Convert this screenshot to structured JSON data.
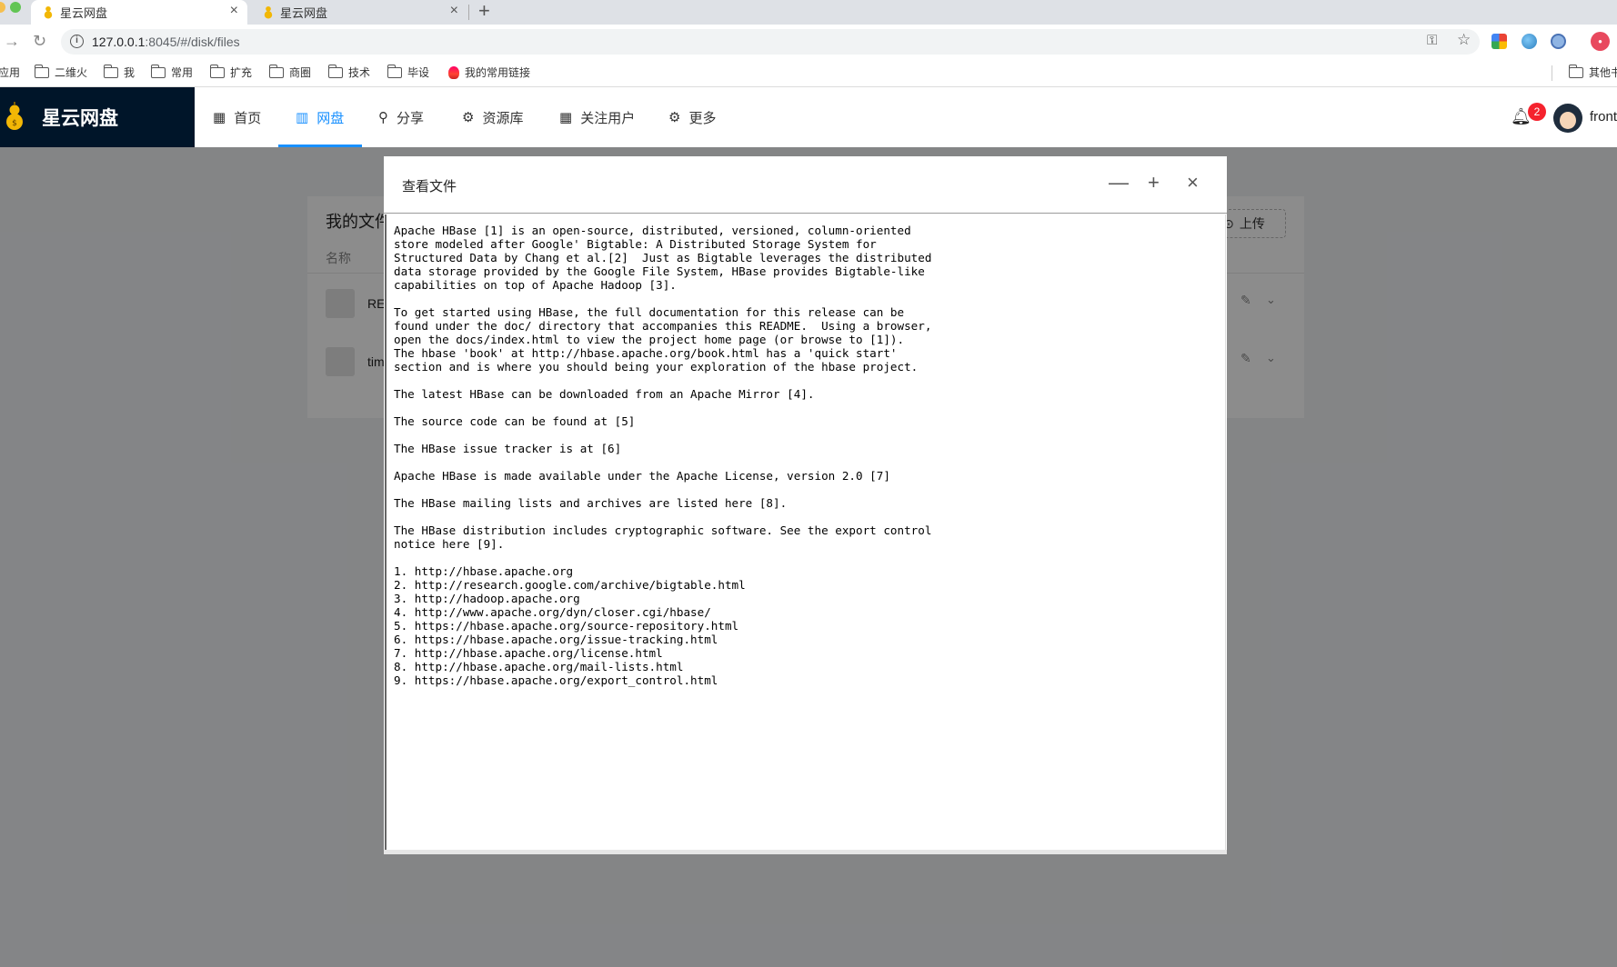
{
  "browser": {
    "tabs": [
      {
        "title": "星云网盘",
        "active": true,
        "close": "×"
      },
      {
        "title": "星云网盘",
        "active": false,
        "close": "×"
      }
    ],
    "new_tab": "+",
    "url_host": "127.0.0.1",
    "url_rest": ":8045/#/disk/files",
    "bookmarks": [
      "应用",
      "二维火",
      "我",
      "常用",
      "扩充",
      "商圈",
      "技术",
      "毕设",
      "我的常用链接",
      "其他书签"
    ]
  },
  "app": {
    "title": "星云网盘",
    "menu": [
      {
        "icon": "▦",
        "label": "首页"
      },
      {
        "icon": "▥",
        "label": "网盘"
      },
      {
        "icon": "⚲",
        "label": "分享"
      },
      {
        "icon": "⚙",
        "label": "资源库"
      },
      {
        "icon": "▦",
        "label": "关注用户"
      },
      {
        "icon": "⚙",
        "label": "更多"
      }
    ],
    "active_menu": "网盘",
    "notification_count": "2",
    "username": "front",
    "accent_color": "#1890ff"
  },
  "files_page": {
    "title": "我的文件",
    "upload_label": "上传",
    "column_name": "名称",
    "rows": [
      {
        "name": "README.txt"
      },
      {
        "name": "timing.txt"
      }
    ]
  },
  "modal": {
    "title": "查看文件",
    "minimize": "—",
    "maximize": "+",
    "close": "×",
    "content": "Apache HBase [1] is an open-source, distributed, versioned, column-oriented\nstore modeled after Google' Bigtable: A Distributed Storage System for\nStructured Data by Chang et al.[2]  Just as Bigtable leverages the distributed\ndata storage provided by the Google File System, HBase provides Bigtable-like\ncapabilities on top of Apache Hadoop [3].\n\nTo get started using HBase, the full documentation for this release can be\nfound under the doc/ directory that accompanies this README.  Using a browser,\nopen the docs/index.html to view the project home page (or browse to [1]).\nThe hbase 'book' at http://hbase.apache.org/book.html has a 'quick start'\nsection and is where you should being your exploration of the hbase project.\n\nThe latest HBase can be downloaded from an Apache Mirror [4].\n\nThe source code can be found at [5]\n\nThe HBase issue tracker is at [6]\n\nApache HBase is made available under the Apache License, version 2.0 [7]\n\nThe HBase mailing lists and archives are listed here [8].\n\nThe HBase distribution includes cryptographic software. See the export control\nnotice here [9].\n\n1. http://hbase.apache.org\n2. http://research.google.com/archive/bigtable.html\n3. http://hadoop.apache.org\n4. http://www.apache.org/dyn/closer.cgi/hbase/\n5. https://hbase.apache.org/source-repository.html\n6. https://hbase.apache.org/issue-tracking.html\n7. http://hbase.apache.org/license.html\n8. http://hbase.apache.org/mail-lists.html\n9. https://hbase.apache.org/export_control.html"
  }
}
